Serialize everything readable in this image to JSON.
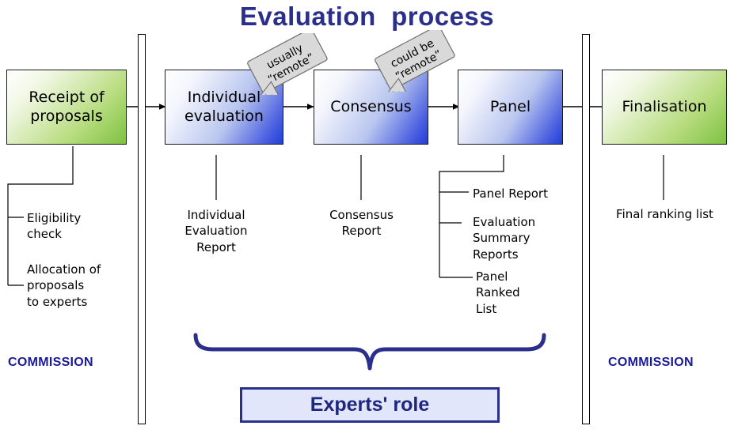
{
  "title": "Evaluation  process",
  "stages": [
    {
      "label": "Receipt of\nproposals",
      "kind": "green"
    },
    {
      "label": "Individual\nevaluation",
      "kind": "blue"
    },
    {
      "label": "Consensus",
      "kind": "blue"
    },
    {
      "label": "Panel",
      "kind": "blue"
    },
    {
      "label": "Finalisation",
      "kind": "green"
    }
  ],
  "callouts": [
    {
      "text": "usually\n“remote”"
    },
    {
      "text": "could be\n“remote”"
    }
  ],
  "outputs": {
    "receipt": [
      {
        "label": "Eligibility\ncheck"
      },
      {
        "label": "Allocation of\nproposals\nto experts"
      }
    ],
    "individual": "Individual\nEvaluation\nReport",
    "consensus": "Consensus\nReport",
    "panel": [
      {
        "label": "Panel Report"
      },
      {
        "label": "Evaluation\nSummary\nReports"
      },
      {
        "label": "Panel\nRanked\nList"
      }
    ],
    "finalisation": "Final ranking list"
  },
  "actors": {
    "left": "COMMISSION",
    "right": "COMMISSION"
  },
  "experts": {
    "label": "Experts' role"
  },
  "colors": {
    "title": "#2b2f8c",
    "commission": "#1a1a9c",
    "experts_border": "#2b2f8c",
    "experts_fill": "#e2e6fa",
    "green_accent": "#7dc242",
    "blue_accent": "#1f3fd8",
    "callout_fill": "#d9d9d9"
  }
}
